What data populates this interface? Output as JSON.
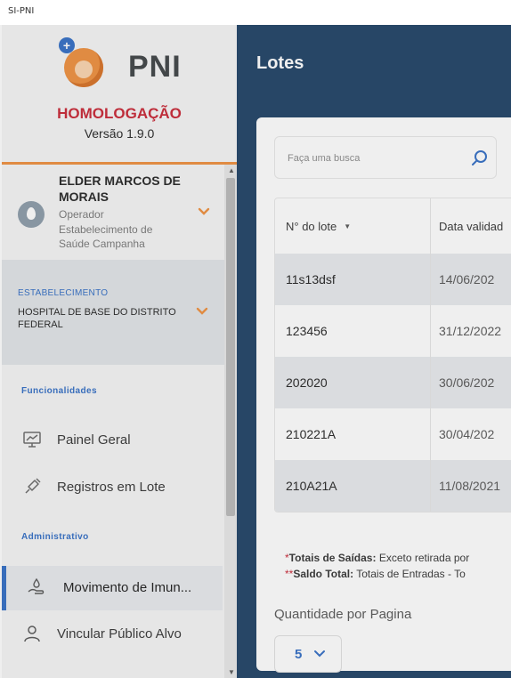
{
  "window": {
    "title": "SI-PNI"
  },
  "sidebar": {
    "brand": "PNI",
    "environment": "HOMOLOGAÇÃO",
    "version": "Versão 1.9.0",
    "user": {
      "name": "ELDER MARCOS DE MORAIS",
      "role": "Operador",
      "org": "Estabelecimento de Saúde Campanha"
    },
    "establishment": {
      "label": "ESTABELECIMENTO",
      "value": "HOSPITAL DE BASE DO DISTRITO FEDERAL"
    },
    "sections": {
      "funcionalidades": "Funcionalidades",
      "administrativo": "Administrativo"
    },
    "items": [
      {
        "label": "Painel Geral",
        "icon": "monitor-chart-icon"
      },
      {
        "label": "Registros em Lote",
        "icon": "syringe-icon"
      },
      {
        "label": "Movimento de Imun...",
        "icon": "hand-drop-icon"
      },
      {
        "label": "Vincular Público Alvo",
        "icon": "person-icon"
      }
    ]
  },
  "header": {
    "title": "Lotes"
  },
  "search": {
    "placeholder": "Faça uma busca"
  },
  "table": {
    "columns": [
      "N° do lote",
      "Data validad"
    ],
    "rows": [
      {
        "lote": "11s13dsf",
        "data": "14/06/202"
      },
      {
        "lote": "123456",
        "data": "31/12/2022"
      },
      {
        "lote": "202020",
        "data": "30/06/202"
      },
      {
        "lote": "210221A",
        "data": "30/04/202"
      },
      {
        "lote": "210A21A",
        "data": "11/08/2021"
      }
    ]
  },
  "footnotes": {
    "saidas_label": "Totais de Saídas:",
    "saidas_text": " Exceto retirada por",
    "saldo_label": "Saldo Total:",
    "saldo_text": " Totais de Entradas - To"
  },
  "pagination": {
    "label": "Quantidade por Pagina",
    "value": "5"
  },
  "colors": {
    "accent": "#2f6cc4",
    "brand_orange": "#ee8e3b",
    "header_bg": "#1c3f63",
    "env_red": "#c82332"
  }
}
